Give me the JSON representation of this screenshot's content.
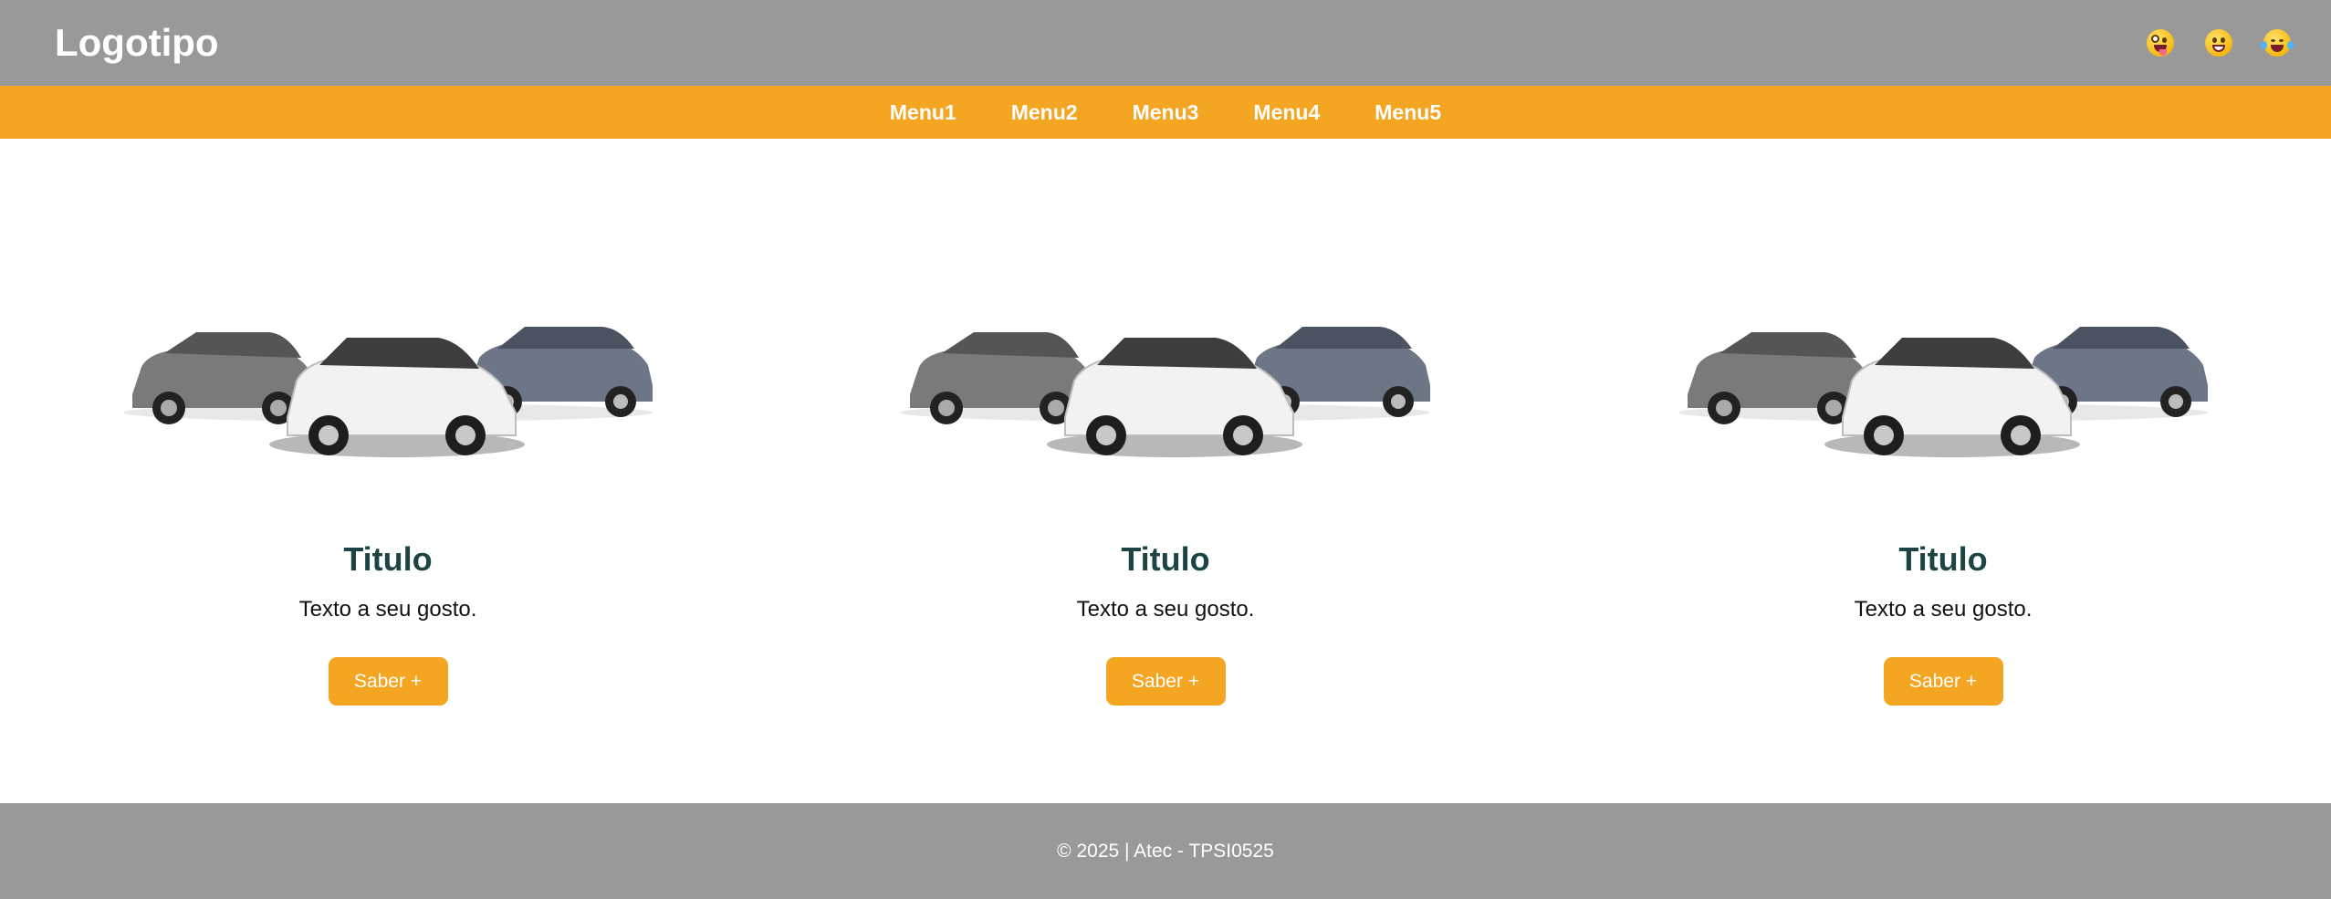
{
  "header": {
    "logo": "Logotipo",
    "icons": [
      "zany-face-icon",
      "grinning-face-icon",
      "tears-of-joy-face-icon"
    ]
  },
  "nav": {
    "items": [
      "Menu1",
      "Menu2",
      "Menu3",
      "Menu4",
      "Menu5"
    ]
  },
  "cards": [
    {
      "title": "Titulo",
      "text": "Texto a seu gosto.",
      "button": "Saber +"
    },
    {
      "title": "Titulo",
      "text": "Texto a seu gosto.",
      "button": "Saber +"
    },
    {
      "title": "Titulo",
      "text": "Texto a seu gosto.",
      "button": "Saber +"
    }
  ],
  "footer": {
    "text": "© 2025 | Atec - TPSI0525"
  },
  "colors": {
    "header": "#999999",
    "accent": "#f4a521",
    "title": "#1d4444"
  }
}
